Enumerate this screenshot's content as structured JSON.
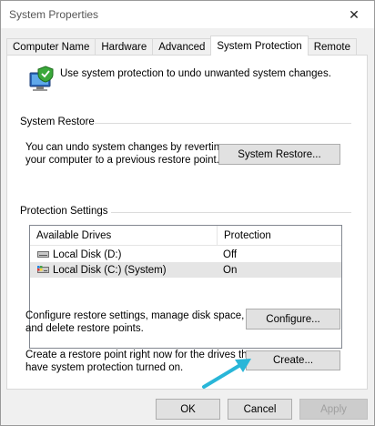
{
  "window": {
    "title": "System Properties",
    "close_glyph": "✕"
  },
  "tabs": [
    {
      "label": "Computer Name",
      "active": false
    },
    {
      "label": "Hardware",
      "active": false
    },
    {
      "label": "Advanced",
      "active": false
    },
    {
      "label": "System Protection",
      "active": true
    },
    {
      "label": "Remote",
      "active": false
    }
  ],
  "intro": {
    "icon": "computer-shield-icon",
    "text": "Use system protection to undo unwanted system changes."
  },
  "system_restore": {
    "group_label": "System Restore",
    "description_line1": "You can undo system changes by reverting",
    "description_line2": "your computer to a previous restore point.",
    "button_label": "System Restore..."
  },
  "protection_settings": {
    "group_label": "Protection Settings",
    "columns": [
      "Available Drives",
      "Protection"
    ],
    "drives": [
      {
        "name": "Local Disk (D:)",
        "protection": "Off",
        "icon": "drive-icon",
        "selected": false
      },
      {
        "name": "Local Disk (C:) (System)",
        "protection": "On",
        "icon": "system-drive-icon",
        "selected": true
      }
    ],
    "configure_text_line1": "Configure restore settings, manage disk space,",
    "configure_text_line2": "and delete restore points.",
    "configure_button": "Configure...",
    "create_text_line1": "Create a restore point right now for the drives that",
    "create_text_line2": "have system protection turned on.",
    "create_button": "Create..."
  },
  "dialog_buttons": {
    "ok": "OK",
    "cancel": "Cancel",
    "apply": "Apply"
  },
  "colors": {
    "arrow": "#29b6d8",
    "selected_row": "#e5e5e5"
  }
}
